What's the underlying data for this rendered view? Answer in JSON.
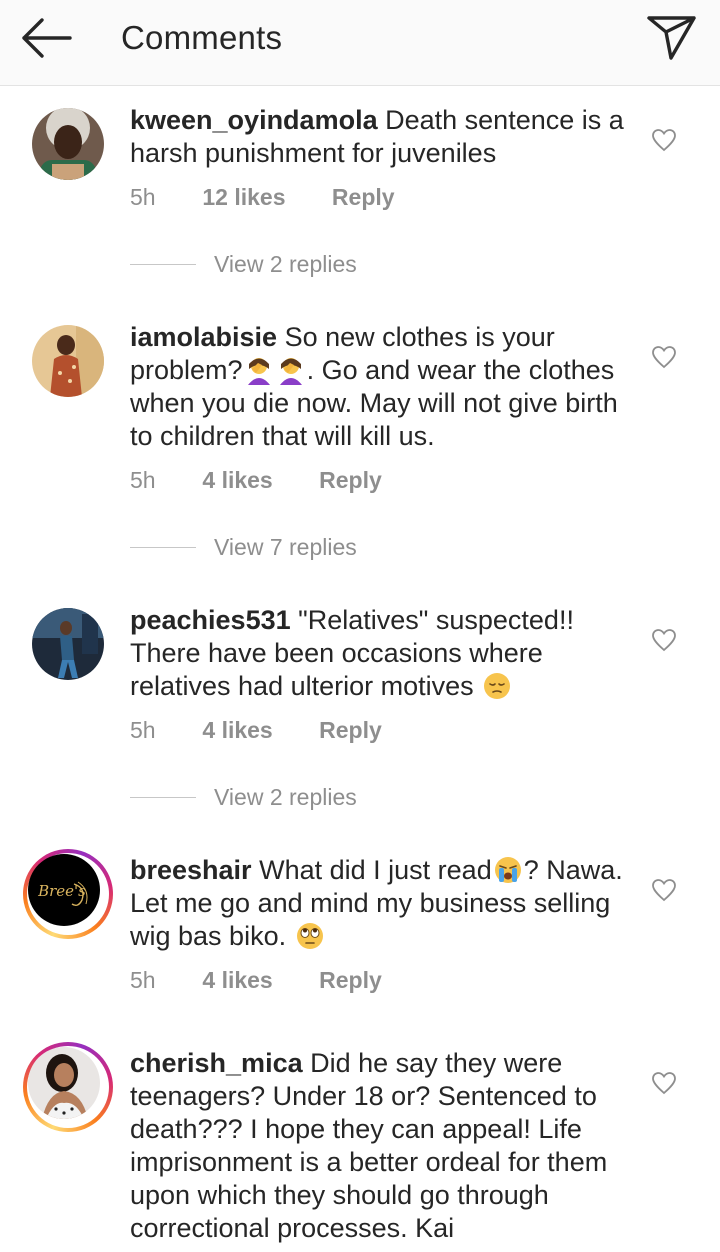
{
  "header": {
    "title": "Comments",
    "back_icon": "arrow-left-icon",
    "send_icon": "paper-plane-icon"
  },
  "comments": [
    {
      "username": "kween_oyindamola",
      "text": "Death sentence is a harsh punishment for juveniles",
      "time": "5h",
      "likes": "12 likes",
      "reply": "Reply",
      "view_replies": "View 2 replies",
      "has_story_ring": false
    },
    {
      "username": "iamolabisie",
      "text_parts": [
        "So new clothes is your problem?",
        ". Go and wear the clothes when you die now. May will not give birth to children that will kill us."
      ],
      "time": "5h",
      "likes": "4 likes",
      "reply": "Reply",
      "view_replies": "View 7 replies",
      "has_story_ring": false
    },
    {
      "username": "peachies531",
      "text": "\"Relatives\" suspected!! There have been occasions where relatives had ulterior motives",
      "time": "5h",
      "likes": "4 likes",
      "reply": "Reply",
      "view_replies": "View 2 replies",
      "has_story_ring": false
    },
    {
      "username": "breeshair",
      "text_parts": [
        "What did I just read",
        "? Nawa. Let me go and mind my business selling wig bas biko."
      ],
      "time": "5h",
      "likes": "4 likes",
      "reply": "Reply",
      "has_story_ring": true,
      "avatar_logo_text": "Bree's"
    },
    {
      "username": "cherish_mica",
      "text": "Did he say they were teenagers? Under 18 or? Sentenced to death??? I hope they can appeal! Life imprisonment is a better ordeal for them upon which they should go through correctional processes. Kai",
      "has_story_ring": true
    }
  ],
  "colors": {
    "text": "#262626",
    "muted": "#8e8e8e",
    "header_bg": "#fafafa",
    "divider": "#c7c7c7"
  }
}
